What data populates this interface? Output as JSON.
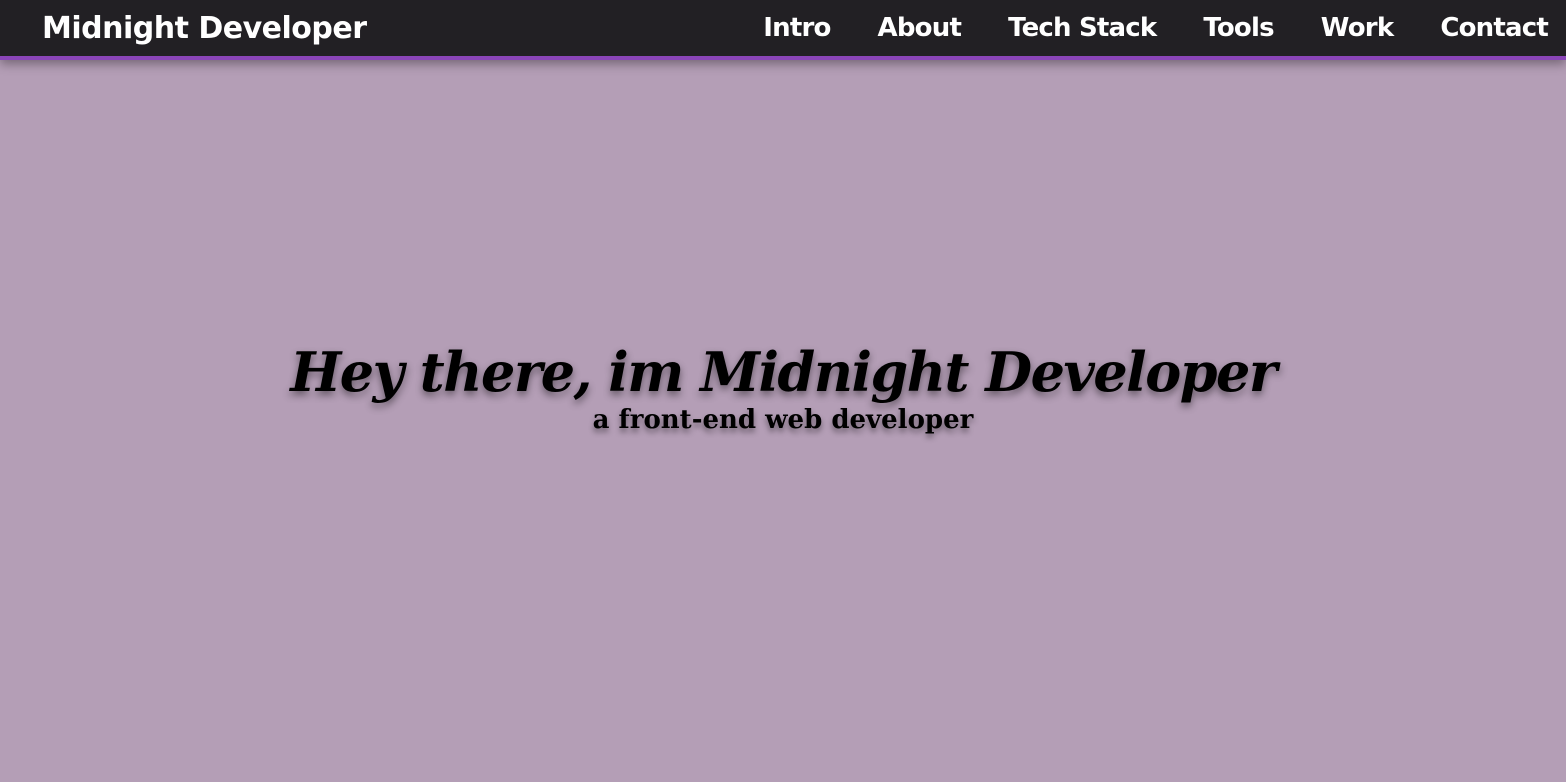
{
  "navbar": {
    "brand": "Midnight Developer",
    "links": [
      {
        "label": "Intro"
      },
      {
        "label": "About"
      },
      {
        "label": "Tech Stack"
      },
      {
        "label": "Tools"
      },
      {
        "label": "Work"
      },
      {
        "label": "Contact"
      }
    ]
  },
  "hero": {
    "title": "Hey there, im Midnight Developer",
    "subtitle": "a front-end web developer"
  },
  "colors": {
    "background": "#b49eb6",
    "navbar": "#222024",
    "accent": "#8a45b8",
    "text_light": "#ffffff",
    "text_dark": "#000000"
  }
}
